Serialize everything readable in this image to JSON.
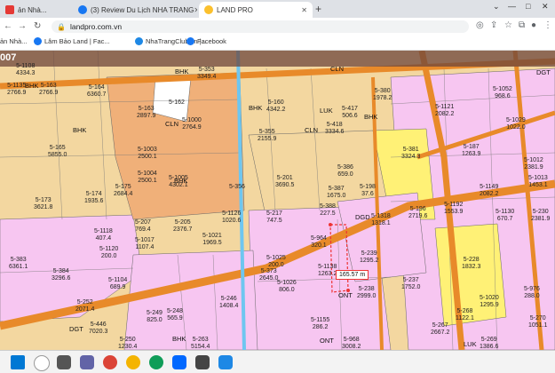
{
  "browser": {
    "tabs": [
      {
        "label": "ản Nhà...",
        "fav_color": "#e53935"
      },
      {
        "label": "(3) Review Du Lịch NHA TRANG",
        "fav_color": "#1877f2"
      },
      {
        "label": "LAND PRO",
        "fav_color": "#fbc02d"
      }
    ],
    "new_tab": "+",
    "controls": [
      "⌄",
      "—",
      "□",
      "✕"
    ],
    "url": "landpro.com.vn",
    "bookmarks": [
      {
        "label": "ản Nhà..."
      },
      {
        "label": "Lâm Bảo Land | Fac..."
      },
      {
        "label": "NhaTrangClub.vn |..."
      },
      {
        "label": "Facebook"
      }
    ]
  },
  "map": {
    "header_code": "007",
    "measure_label": "165.57 m",
    "zones": [
      "BHK",
      "BHK",
      "CLN",
      "LUK",
      "BHK",
      "CLN",
      "CLN",
      "BHK",
      "BHK",
      "DGD",
      "DGT",
      "ONT",
      "ONT",
      "BHK",
      "LUK",
      "DGT",
      "BHK"
    ],
    "parcels": [
      {
        "id": "5-1108",
        "area": "4334.3"
      },
      {
        "id": "5-1135",
        "area": "2766.9"
      },
      {
        "id": "5-163",
        "area": "2766.9"
      },
      {
        "id": "5-353",
        "area": "3349.4"
      },
      {
        "id": "5-164",
        "area": "6360.7"
      },
      {
        "id": "5-162",
        "area": ""
      },
      {
        "id": "5-163",
        "area": "2897.9"
      },
      {
        "id": "5-1000",
        "area": "2764.9"
      },
      {
        "id": "5-160",
        "area": "4342.2"
      },
      {
        "id": "5-355",
        "area": "2155.9"
      },
      {
        "id": "5-418",
        "area": "3334.6"
      },
      {
        "id": "5-417",
        "area": "506.6"
      },
      {
        "id": "5-380",
        "area": "1978.2"
      },
      {
        "id": "5-381",
        "area": "3324.3"
      },
      {
        "id": "5-165",
        "area": "5855.0"
      },
      {
        "id": "5-1003",
        "area": "2500.1"
      },
      {
        "id": "5-1004",
        "area": "2500.1"
      },
      {
        "id": "5-1005",
        "area": "4302.1"
      },
      {
        "id": "5-201",
        "area": "3690.5"
      },
      {
        "id": "5-386",
        "area": "659.0"
      },
      {
        "id": "5-387",
        "area": "1675.0"
      },
      {
        "id": "5-198",
        "area": "37.6"
      },
      {
        "id": "5-174",
        "area": "1935.6"
      },
      {
        "id": "5-175",
        "area": "2684.4"
      },
      {
        "id": "5-173",
        "area": "3621.8"
      },
      {
        "id": "5-356",
        "area": ""
      },
      {
        "id": "5-217",
        "area": "747.5"
      },
      {
        "id": "5-388",
        "area": "227.5"
      },
      {
        "id": "5-207",
        "area": "769.4"
      },
      {
        "id": "5-205",
        "area": "2376.7"
      },
      {
        "id": "5-1126",
        "area": "1020.6"
      },
      {
        "id": "5-1021",
        "area": "1969.5"
      },
      {
        "id": "5-964",
        "area": "320.1"
      },
      {
        "id": "5-1318",
        "area": "1318.1"
      },
      {
        "id": "5-196",
        "area": "2719.6"
      },
      {
        "id": "5-1192",
        "area": "1553.9"
      },
      {
        "id": "5-1149",
        "area": "2082.2"
      },
      {
        "id": "5-1118",
        "area": "407.4"
      },
      {
        "id": "5-1120",
        "area": "200.0"
      },
      {
        "id": "5-1017",
        "area": "1107.4"
      },
      {
        "id": "5-1025",
        "area": "200.0"
      },
      {
        "id": "5-1138",
        "area": "1263.2"
      },
      {
        "id": "5-239",
        "area": "1295.2"
      },
      {
        "id": "5-228",
        "area": "1832.3"
      },
      {
        "id": "5-1130",
        "area": "670.7"
      },
      {
        "id": "5-383",
        "area": "6361.1"
      },
      {
        "id": "5-384",
        "area": "3296.6"
      },
      {
        "id": "5-1104",
        "area": "689.9"
      },
      {
        "id": "5-246",
        "area": "1408.4"
      },
      {
        "id": "5-373",
        "area": "2645.0"
      },
      {
        "id": "5-1026",
        "area": "806.0"
      },
      {
        "id": "5-237",
        "area": "1752.0"
      },
      {
        "id": "5-238",
        "area": "2999.0"
      },
      {
        "id": "5-252",
        "area": "2071.4"
      },
      {
        "id": "5-249",
        "area": "825.0"
      },
      {
        "id": "5-248",
        "area": "565.9"
      },
      {
        "id": "5-446",
        "area": "7020.3"
      },
      {
        "id": "5-250",
        "area": "1230.4"
      },
      {
        "id": "5-263",
        "area": "5154.4"
      },
      {
        "id": "5-1155",
        "area": "286.2"
      },
      {
        "id": "5-968",
        "area": "3008.2"
      },
      {
        "id": "5-268",
        "area": "1122.1"
      },
      {
        "id": "5-267",
        "area": "2667.2"
      },
      {
        "id": "5-269",
        "area": "1386.6"
      },
      {
        "id": "5-270",
        "area": "1051.1"
      },
      {
        "id": "5-1052",
        "area": "968.6"
      },
      {
        "id": "5-1029",
        "area": "1022.0"
      },
      {
        "id": "5-1012",
        "area": "2381.9"
      },
      {
        "id": "5-1013",
        "area": "1453.1"
      },
      {
        "id": "5-230",
        "area": "2381.9"
      },
      {
        "id": "5-976",
        "area": "288.0"
      },
      {
        "id": "5-1020",
        "area": "1295.9"
      },
      {
        "id": "5-1121",
        "area": "2082.2"
      },
      {
        "id": "5-187",
        "area": "1263.9"
      }
    ]
  }
}
